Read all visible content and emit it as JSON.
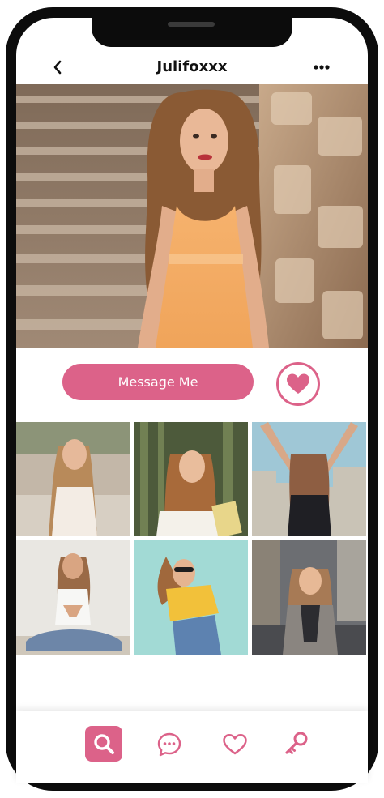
{
  "profile": {
    "username": "Julifoxxx"
  },
  "actions": {
    "message_label": "Message Me"
  },
  "colors": {
    "accent": "#dc6289",
    "frame": "#0c0c0c"
  },
  "icons": {
    "back": "chevron-left-icon",
    "more": "more-horizontal-icon",
    "like": "heart-icon",
    "tabs": [
      "search-icon",
      "chat-icon",
      "heart-icon",
      "key-icon"
    ]
  },
  "gallery": {
    "photo_count": 6
  },
  "tabbar": {
    "active_tab": "search"
  }
}
